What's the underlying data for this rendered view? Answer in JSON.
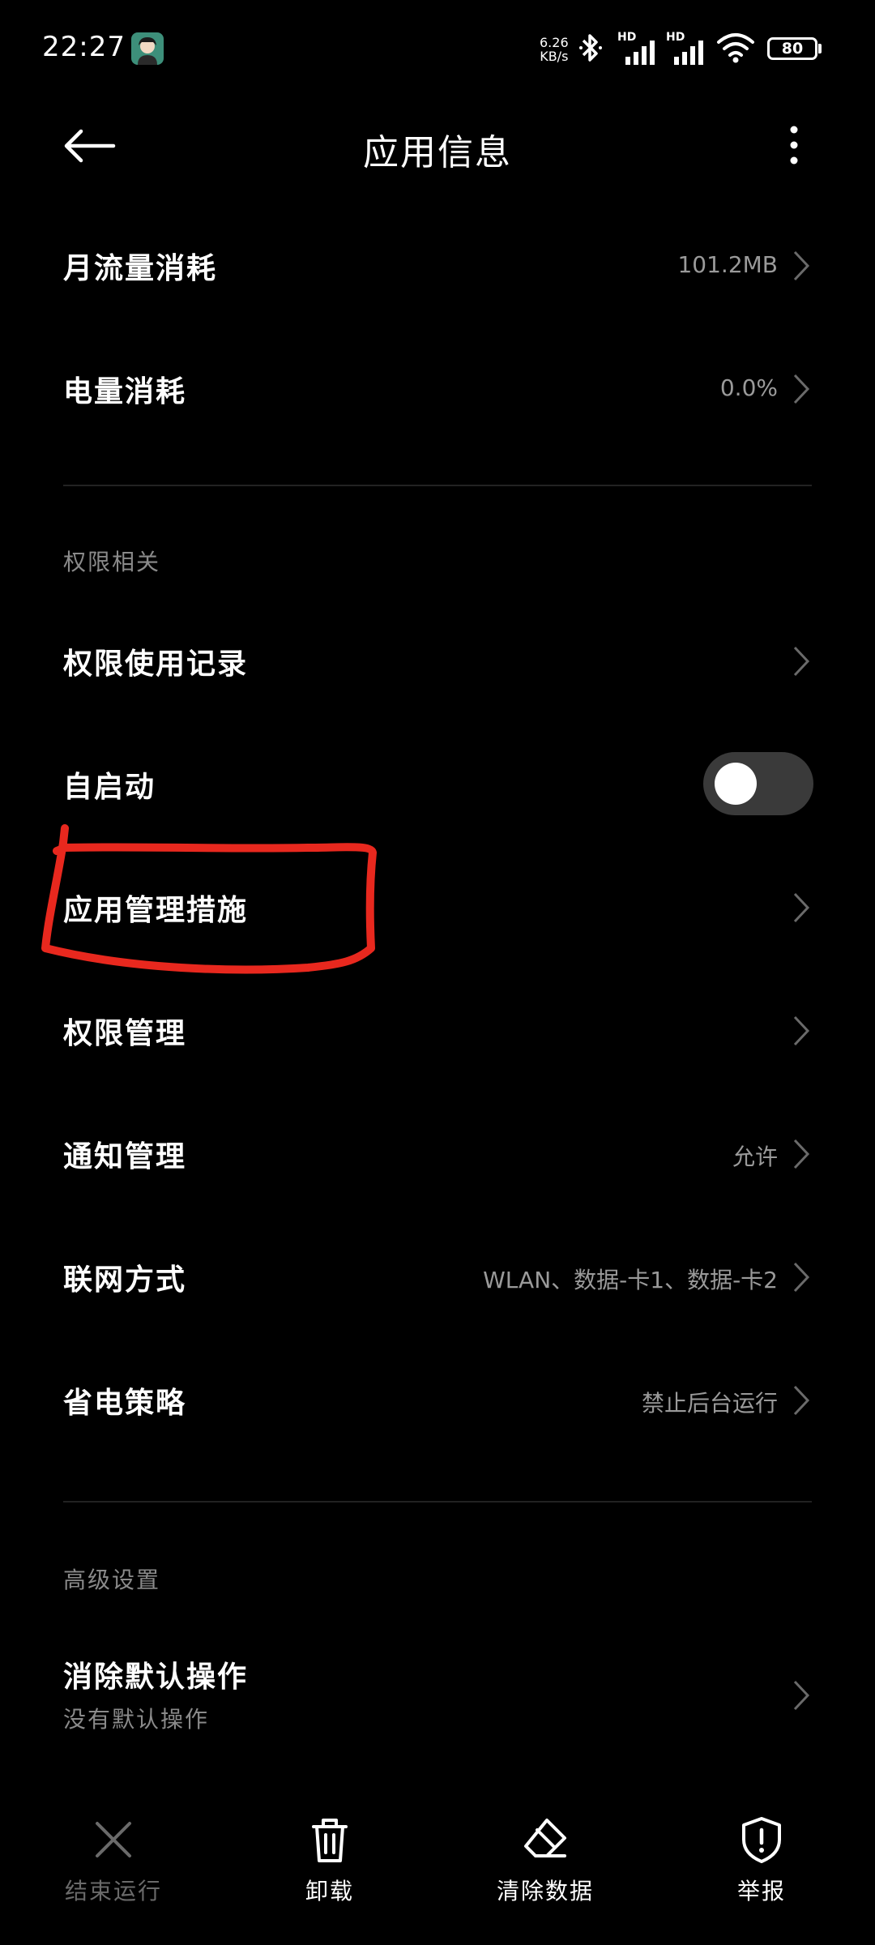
{
  "status_bar": {
    "time": "22:27",
    "net_speed_value": "6.26",
    "net_speed_unit": "KB/s",
    "battery_level": "80",
    "signal_label_1": "HD",
    "signal_label_2": "HD"
  },
  "header": {
    "title": "应用信息"
  },
  "rows": {
    "traffic": {
      "label": "月流量消耗",
      "value": "101.2MB"
    },
    "battery": {
      "label": "电量消耗",
      "value": "0.0%"
    }
  },
  "permissions_section": {
    "title": "权限相关",
    "usage_record": {
      "label": "权限使用记录"
    },
    "autostart": {
      "label": "自启动",
      "enabled": false
    },
    "app_management": {
      "label": "应用管理措施"
    },
    "permission_mgmt": {
      "label": "权限管理"
    },
    "notification": {
      "label": "通知管理",
      "value": "允许"
    },
    "network": {
      "label": "联网方式",
      "value": "WLAN、数据-卡1、数据-卡2"
    },
    "power_saving": {
      "label": "省电策略",
      "value": "禁止后台运行"
    }
  },
  "advanced_section": {
    "title": "高级设置",
    "clear_defaults": {
      "label": "消除默认操作",
      "subtitle": "没有默认操作"
    }
  },
  "bottom_bar": {
    "force_stop": "结束运行",
    "uninstall": "卸载",
    "clear_data": "清除数据",
    "report": "举报"
  },
  "colors": {
    "background": "#000000",
    "annotation": "#e8281e",
    "disabled": "#6a6a6a"
  }
}
